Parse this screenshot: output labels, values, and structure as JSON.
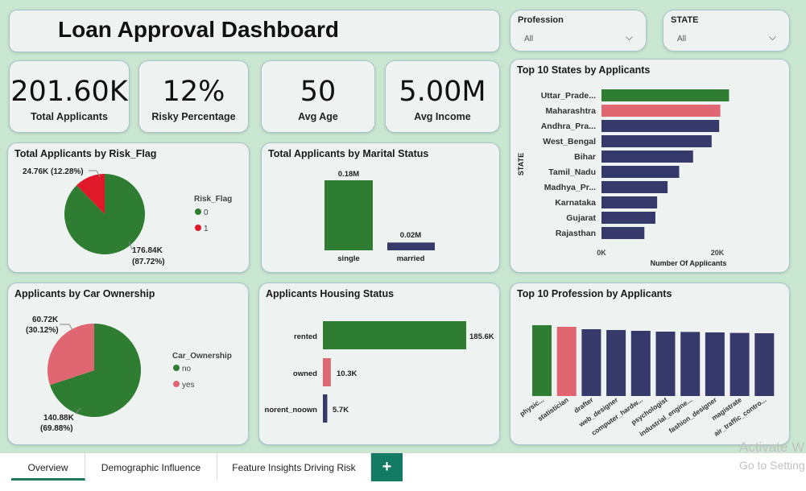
{
  "header": {
    "title": "Loan Approval Dashboard"
  },
  "slicers": [
    {
      "label": "Profession",
      "value": "All"
    },
    {
      "label": "STATE",
      "value": "All"
    }
  ],
  "kpis": [
    {
      "value": "201.60K",
      "label": "Total Applicants"
    },
    {
      "value": "12%",
      "label": "Risky Percentage"
    },
    {
      "value": "50",
      "label": "Avg Age"
    },
    {
      "value": "5.00M",
      "label": "Avg Income"
    }
  ],
  "colors": {
    "green": "#2e7d32",
    "pink": "#e06771",
    "red": "#e0192a",
    "navy": "#353a6b"
  },
  "risk_card": {
    "title": "Total Applicants by Risk_Flag",
    "legend_title": "Risk_Flag",
    "slices": [
      {
        "name": "0",
        "value": 176.84,
        "label_line1": "176.84K",
        "label_line2": "(87.72%)",
        "color": "#2e7d32"
      },
      {
        "name": "1",
        "value": 24.76,
        "label_line1": "24.76K (12.28%)",
        "label_line2": "",
        "color": "#e0192a"
      }
    ]
  },
  "marital_card": {
    "title": "Total Applicants by Marital Status",
    "bars": [
      {
        "category": "single",
        "value": 0.18,
        "label": "0.18M"
      },
      {
        "category": "married",
        "value": 0.02,
        "label": "0.02M"
      }
    ]
  },
  "car_card": {
    "title": "Applicants by Car Ownership",
    "legend_title": "Car_Ownership",
    "slices": [
      {
        "name": "no",
        "value": 140.88,
        "label_line1": "140.88K",
        "label_line2": "(69.88%)",
        "color": "#2e7d32"
      },
      {
        "name": "yes",
        "value": 60.72,
        "label_line1": "60.72K",
        "label_line2": "(30.12%)",
        "color": "#e06771"
      }
    ]
  },
  "housing_card": {
    "title": "Applicants Housing Status",
    "bars": [
      {
        "category": "rented",
        "value": 185.6,
        "label": "185.6K",
        "color": "#2e7d32"
      },
      {
        "category": "owned",
        "value": 10.3,
        "label": "10.3K",
        "color": "#e06771"
      },
      {
        "category": "norent_noown",
        "value": 5.7,
        "label": "5.7K",
        "color": "#353a6b"
      }
    ]
  },
  "states_card": {
    "title": "Top 10 States by Applicants",
    "y_axis_title": "STATE",
    "x_axis_title": "Number Of Applicants",
    "x_ticks": [
      "0K",
      "20K"
    ],
    "bars": [
      {
        "category": "Uttar_Prade...",
        "value": 22.0,
        "color": "#2e7d32"
      },
      {
        "category": "Maharashtra",
        "value": 20.5,
        "color": "#e06771"
      },
      {
        "category": "Andhra_Pra...",
        "value": 20.3,
        "color": "#353a6b"
      },
      {
        "category": "West_Bengal",
        "value": 19.0,
        "color": "#353a6b"
      },
      {
        "category": "Bihar",
        "value": 15.8,
        "color": "#353a6b"
      },
      {
        "category": "Tamil_Nadu",
        "value": 13.4,
        "color": "#353a6b"
      },
      {
        "category": "Madhya_Pr...",
        "value": 11.4,
        "color": "#353a6b"
      },
      {
        "category": "Karnataka",
        "value": 9.6,
        "color": "#353a6b"
      },
      {
        "category": "Gujarat",
        "value": 9.3,
        "color": "#353a6b"
      },
      {
        "category": "Rajasthan",
        "value": 7.4,
        "color": "#353a6b"
      }
    ]
  },
  "profession_card": {
    "title": "Top 10 Profession by Applicants",
    "bars": [
      {
        "category": "physic...",
        "value": 4.4,
        "color": "#2e7d32"
      },
      {
        "category": "statistician",
        "value": 4.3,
        "color": "#e06771"
      },
      {
        "category": "drafter",
        "value": 4.15,
        "color": "#353a6b"
      },
      {
        "category": "web_designer",
        "value": 4.1,
        "color": "#353a6b"
      },
      {
        "category": "computer_hardw...",
        "value": 4.05,
        "color": "#353a6b"
      },
      {
        "category": "psychologist",
        "value": 4.0,
        "color": "#353a6b"
      },
      {
        "category": "industrial_engine...",
        "value": 3.98,
        "color": "#353a6b"
      },
      {
        "category": "fashion_designer",
        "value": 3.95,
        "color": "#353a6b"
      },
      {
        "category": "magistrate",
        "value": 3.92,
        "color": "#353a6b"
      },
      {
        "category": "air_traffic_contro...",
        "value": 3.9,
        "color": "#353a6b"
      }
    ]
  },
  "tabs": [
    {
      "label": "Overview",
      "active": true
    },
    {
      "label": "Demographic Influence",
      "active": false
    },
    {
      "label": "Feature Insights Driving Risk",
      "active": false
    }
  ],
  "add_tab_label": "+",
  "watermark": {
    "line1": "Activate W",
    "line2": "Go to Setting"
  }
}
